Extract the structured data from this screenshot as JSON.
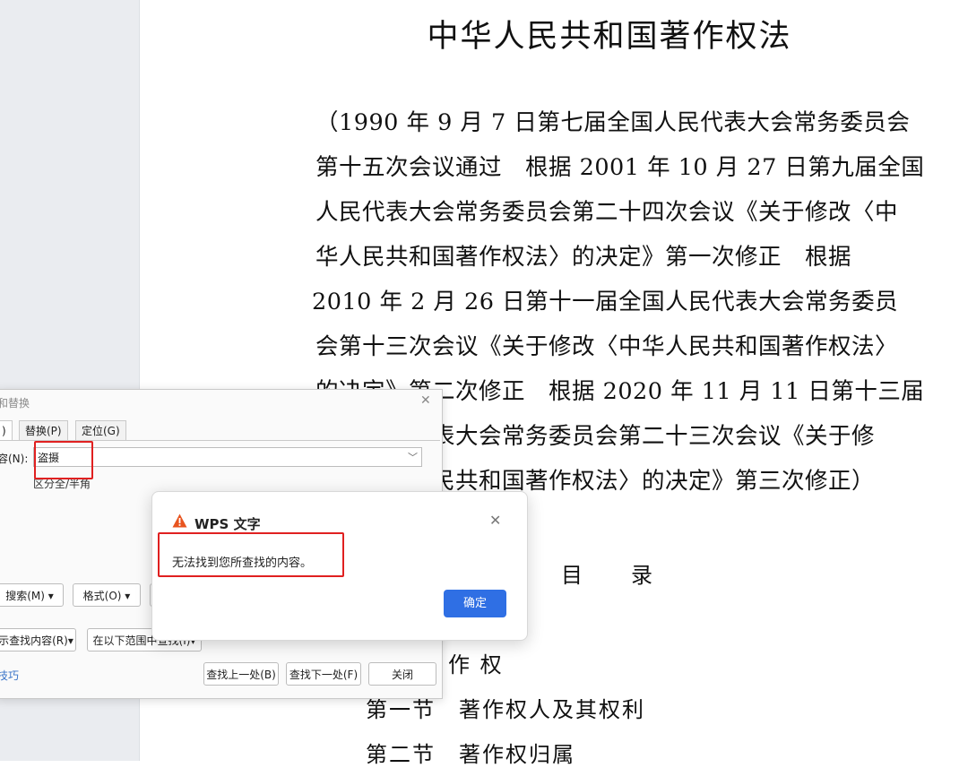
{
  "document": {
    "title": "中华人民共和国著作权法",
    "preamble_lines": [
      "（1990 年 9 月 7 日第七届全国人民代表大会常务委员会",
      "第十五次会议通过　根据 2001 年 10 月 27 日第九届全国",
      "人民代表大会常务委员会第二十四次会议《关于修改〈中",
      "华人民共和国著作权法〉的决定》第一次修正　根据",
      "2010 年 2 月 26 日第十一届全国人民代表大会常务委员",
      "会第十三次会议《关于修改〈中华人民共和国著作权法〉",
      "的决定》第二次修正　根据 2020 年 11 月 11 日第十三届",
      "全国人民代表大会常务委员会第二十三次会议《关于修",
      "改〈中华人民共和国著作权法〉的决定》第三次修正）"
    ],
    "toc_heading": "目　　录",
    "toc_partial": "作  权",
    "toc_items": [
      "第一节　著作权人及其权利",
      "第二节　著作权归属"
    ]
  },
  "find_dialog": {
    "title": "和替换",
    "tabs": [
      ")",
      "替换(P)",
      "定位(G)"
    ],
    "find_label": "容(N):",
    "find_value": "盗摄",
    "hint": "区分全/半角",
    "search_button": "搜索(M) ▾",
    "format_button": "格式(O) ▾",
    "highlight_button": "示查找内容(R)▾",
    "scope_button": "在以下范围中查找(I)▾",
    "tips_link": "技巧",
    "find_prev_button": "查找上一处(B)",
    "find_next_button": "查找下一处(F)",
    "close_button": "关闭"
  },
  "alert": {
    "title": "WPS 文字",
    "message": "无法找到您所查找的内容。",
    "ok_button": "确定",
    "icon": "warning-icon",
    "accent_color": "#2f6fe4",
    "warning_color": "#e8541f"
  },
  "highlight_color": "#e02020"
}
